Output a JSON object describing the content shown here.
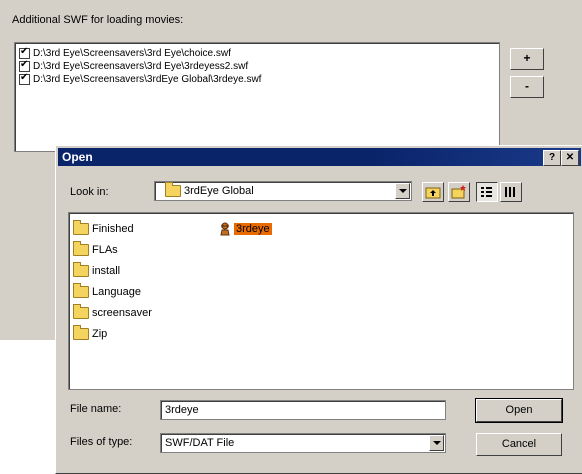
{
  "background": {
    "label": "Additional SWF for loading movies:",
    "swf_files": [
      "D:\\3rd Eye\\Screensavers\\3rd Eye\\choice.swf",
      "D:\\3rd Eye\\Screensavers\\3rd Eye\\3rdeyess2.swf",
      "D:\\3rd Eye\\Screensavers\\3rdEye Global\\3rdeye.swf"
    ],
    "add_button": "+",
    "remove_button": "-"
  },
  "dialog": {
    "title": "Open",
    "help_button": "?",
    "close_button": "✕",
    "look_in_label": "Look in:",
    "look_in_value": "3rdEye Global",
    "folders": [
      "Finished",
      "FLAs",
      "install",
      "Language",
      "screensaver",
      "Zip"
    ],
    "selected_file": "3rdeye",
    "file_name_label": "File name:",
    "file_name_value": "3rdeye",
    "file_type_label": "Files of type:",
    "file_type_value": "SWF/DAT File",
    "open_button": "Open",
    "cancel_button": "Cancel",
    "icons": [
      "folder-icon",
      "up-folder-icon",
      "new-folder-icon",
      "list-view-icon",
      "details-view-icon",
      "swf-file-icon"
    ]
  }
}
